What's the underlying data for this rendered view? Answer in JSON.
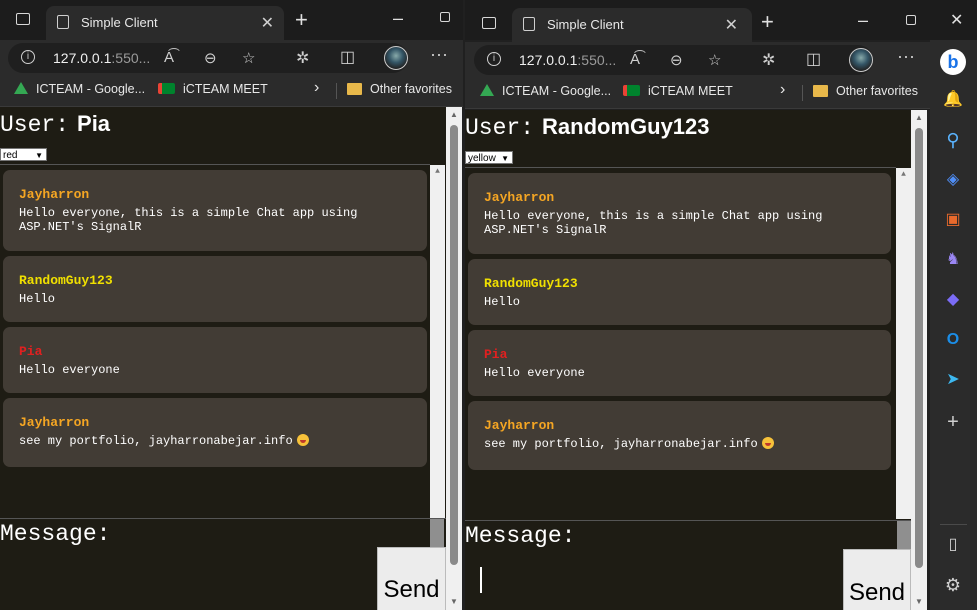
{
  "left_window": {
    "tab_title": "Simple Client",
    "url_host": "127.0.0.1",
    "url_port": ":550...",
    "favorites": [
      "ICTEAM  - Google...",
      "iCTEAM MEET"
    ],
    "other_favorites": "Other favorites",
    "user_label": "User:",
    "username": "Pia",
    "color_select": "red",
    "messages": [
      {
        "name": "Jayharron",
        "color": "#f5a623",
        "text": "Hello everyone, this is a simple Chat app using ASP.NET's SignalR"
      },
      {
        "name": "RandomGuy123",
        "color": "#f0e000",
        "text": "Hello"
      },
      {
        "name": "Pia",
        "color": "#e02020",
        "text": "Hello everyone"
      },
      {
        "name": "Jayharron",
        "color": "#f5a623",
        "text": "see my portfolio, jayharronabejar.info"
      }
    ],
    "message_label": "Message:",
    "send_label": "Send"
  },
  "right_window": {
    "tab_title": "Simple Client",
    "url_host": "127.0.0.1",
    "url_port": ":550...",
    "favorites": [
      "ICTEAM  - Google...",
      "iCTEAM MEET"
    ],
    "other_favorites": "Other favorites",
    "user_label": "User:",
    "username": "RandomGuy123",
    "color_select": "yellow",
    "messages": [
      {
        "name": "Jayharron",
        "color": "#f5a623",
        "text": "Hello everyone, this is a simple Chat app using ASP.NET's SignalR"
      },
      {
        "name": "RandomGuy123",
        "color": "#f0e000",
        "text": "Hello"
      },
      {
        "name": "Pia",
        "color": "#e02020",
        "text": "Hello everyone"
      },
      {
        "name": "Jayharron",
        "color": "#f5a623",
        "text": "see my portfolio, jayharronabejar.info"
      }
    ],
    "message_label": "Message:",
    "send_label": "Send"
  },
  "icons": {
    "tab_actions": "tab-actions-icon",
    "new_tab": "plus-icon",
    "close_tab": "close-icon",
    "read_aloud": "read-aloud-icon",
    "zoom": "zoom-icon",
    "favorite": "star-icon",
    "extensions": "puzzle-icon",
    "split_screen": "split-screen-icon",
    "more": "more-icon",
    "sidebar": [
      "bing-icon",
      "bell-icon",
      "search-icon",
      "tag-icon",
      "briefcase-icon",
      "games-icon",
      "copilot-icon",
      "outlook-icon",
      "send-icon",
      "add-icon",
      "hide-sidebar-icon",
      "settings-icon"
    ]
  }
}
